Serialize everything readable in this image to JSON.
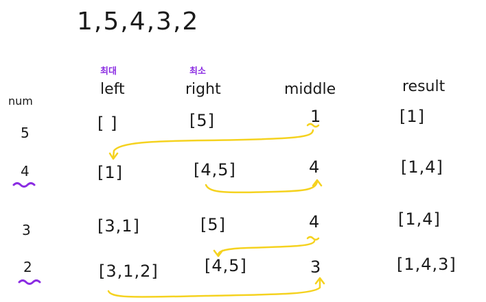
{
  "sequence": "1,5,4,3,2",
  "headers": {
    "num": "num",
    "left": "left",
    "right": "right",
    "middle": "middle",
    "result": "result"
  },
  "annotations": {
    "left": "최대",
    "right": "최소"
  },
  "rows": [
    {
      "num": "5",
      "left": "[  ]",
      "right": "[5]",
      "middle": "1",
      "result": "[1]"
    },
    {
      "num": "4",
      "left": "[1]",
      "right": "[4,5]",
      "middle": "4",
      "result": "[1,4]"
    },
    {
      "num": "3",
      "left": "[3,1]",
      "right": "[5]",
      "middle": "4",
      "result": "[1,4]"
    },
    {
      "num": "2",
      "left": "[3,1,2]",
      "right": "[4,5]",
      "middle": "3",
      "result": "[1,4,3]"
    }
  ],
  "colors": {
    "ink": "#1a1a1a",
    "arrow": "#f5d21f",
    "highlight": "#8a2be2"
  }
}
